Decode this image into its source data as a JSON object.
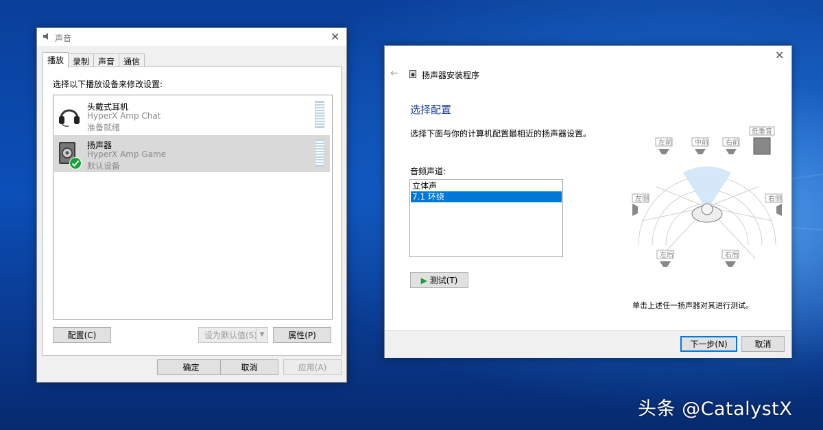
{
  "sound_dialog": {
    "title": "声音",
    "tabs": [
      "播放",
      "录制",
      "声音",
      "通信"
    ],
    "instruction": "选择以下播放设备来修改设置:",
    "devices": [
      {
        "name": "头戴式耳机",
        "model": "HyperX Amp Chat",
        "status": "准备就绪"
      },
      {
        "name": "扬声器",
        "model": "HyperX Amp Game",
        "status": "默认设备"
      }
    ],
    "configure_label": "配置(C)",
    "set_default_label": "设为默认值(S)",
    "properties_label": "属性(P)",
    "ok_label": "确定",
    "cancel_label": "取消",
    "apply_label": "应用(A)"
  },
  "speaker_setup": {
    "title": "扬声器安装程序",
    "heading": "选择配置",
    "description": "选择下面与你的计算机配置最相近的扬声器设置。",
    "channels_label": "音频声道:",
    "channels": [
      "立体声",
      "7.1 环绕"
    ],
    "selected_channel": "7.1 环绕",
    "test_label": "测试(T)",
    "hint": "单击上述任一扬声器对其进行测试。",
    "next_label": "下一步(N)",
    "cancel_label": "取消",
    "speakers": {
      "front_left": "左前",
      "front_center": "中前",
      "front_right": "右前",
      "subwoofer": "低重音",
      "side_left": "左侧",
      "side_right": "右侧",
      "rear_left": "左后",
      "rear_right": "右后"
    }
  },
  "watermark": "头条 @CatalystX",
  "colors": {
    "accent": "#0078d7",
    "heading": "#1e3f9a",
    "check": "#1aa037"
  }
}
